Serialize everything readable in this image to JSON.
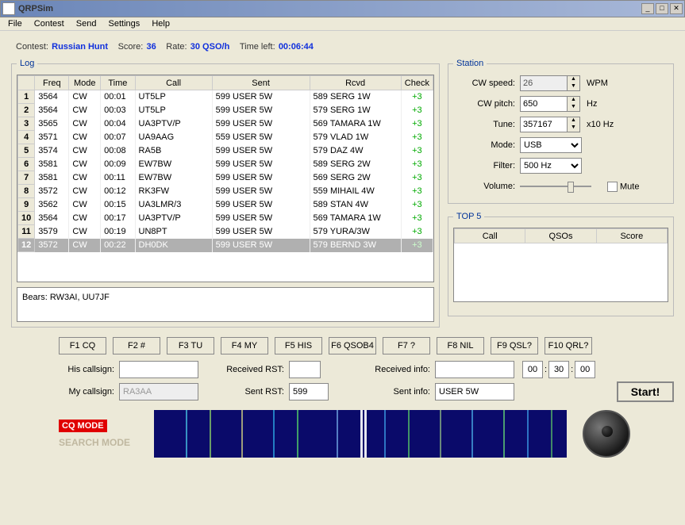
{
  "window": {
    "title": "QRPSim"
  },
  "menu": [
    "File",
    "Contest",
    "Send",
    "Settings",
    "Help"
  ],
  "score": {
    "contest_label": "Contest:",
    "contest": "Russian Hunt",
    "score_label": "Score:",
    "score": "36",
    "rate_label": "Rate:",
    "rate": "30 QSO/h",
    "time_label": "Time left:",
    "time": "00:06:44"
  },
  "log": {
    "legend": "Log",
    "headers": [
      "",
      "Freq",
      "Mode",
      "Time",
      "Call",
      "Sent",
      "Rcvd",
      "Check"
    ],
    "rows": [
      {
        "n": "1",
        "freq": "3564",
        "mode": "CW",
        "time": "00:01",
        "call": "UT5LP",
        "sent": "599 USER 5W",
        "rcvd": "589 SERG 1W",
        "check": "+3"
      },
      {
        "n": "2",
        "freq": "3564",
        "mode": "CW",
        "time": "00:03",
        "call": "UT5LP",
        "sent": "599 USER 5W",
        "rcvd": "579 SERG 1W",
        "check": "+3"
      },
      {
        "n": "3",
        "freq": "3565",
        "mode": "CW",
        "time": "00:04",
        "call": "UA3PTV/P",
        "sent": "599 USER 5W",
        "rcvd": "569 TAMARA 1W",
        "check": "+3"
      },
      {
        "n": "4",
        "freq": "3571",
        "mode": "CW",
        "time": "00:07",
        "call": "UA9AAG",
        "sent": "559 USER 5W",
        "rcvd": "579 VLAD 1W",
        "check": "+3"
      },
      {
        "n": "5",
        "freq": "3574",
        "mode": "CW",
        "time": "00:08",
        "call": "RA5B",
        "sent": "599 USER 5W",
        "rcvd": "579 DAZ 4W",
        "check": "+3"
      },
      {
        "n": "6",
        "freq": "3581",
        "mode": "CW",
        "time": "00:09",
        "call": "EW7BW",
        "sent": "599 USER 5W",
        "rcvd": "589 SERG 2W",
        "check": "+3"
      },
      {
        "n": "7",
        "freq": "3581",
        "mode": "CW",
        "time": "00:11",
        "call": "EW7BW",
        "sent": "599 USER 5W",
        "rcvd": "569 SERG 2W",
        "check": "+3"
      },
      {
        "n": "8",
        "freq": "3572",
        "mode": "CW",
        "time": "00:12",
        "call": "RK3FW",
        "sent": "599 USER 5W",
        "rcvd": "559 MIHAIL 4W",
        "check": "+3"
      },
      {
        "n": "9",
        "freq": "3562",
        "mode": "CW",
        "time": "00:15",
        "call": "UA3LMR/3",
        "sent": "599 USER 5W",
        "rcvd": "589 STAN 4W",
        "check": "+3"
      },
      {
        "n": "10",
        "freq": "3564",
        "mode": "CW",
        "time": "00:17",
        "call": "UA3PTV/P",
        "sent": "599 USER 5W",
        "rcvd": "569 TAMARA 1W",
        "check": "+3"
      },
      {
        "n": "11",
        "freq": "3579",
        "mode": "CW",
        "time": "00:19",
        "call": "UN8PT",
        "sent": "599 USER 5W",
        "rcvd": "579 YURA/3W",
        "check": "+3"
      },
      {
        "n": "12",
        "freq": "3572",
        "mode": "CW",
        "time": "00:22",
        "call": "DH0DK",
        "sent": "599 USER 5W",
        "rcvd": "579 BERND 3W",
        "check": "+3"
      }
    ],
    "bears": "Bears: RW3AI, UU7JF"
  },
  "station": {
    "legend": "Station",
    "cw_speed_label": "CW speed:",
    "cw_speed": "26",
    "wpm": "WPM",
    "cw_pitch_label": "CW pitch:",
    "cw_pitch": "650",
    "hz": "Hz",
    "tune_label": "Tune:",
    "tune": "357167",
    "x10hz": "x10 Hz",
    "mode_label": "Mode:",
    "mode": "USB",
    "filter_label": "Filter:",
    "filter": "500 Hz",
    "volume_label": "Volume:",
    "mute_label": "Mute"
  },
  "top5": {
    "legend": "TOP 5",
    "headers": [
      "Call",
      "QSOs",
      "Score"
    ]
  },
  "fkeys": [
    "F1 CQ",
    "F2 #",
    "F3 TU",
    "F4 MY",
    "F5 HIS",
    "F6 QSOB4",
    "F7 ?",
    "F8 NIL",
    "F9 QSL?",
    "F10 QRL?"
  ],
  "inputs": {
    "his_call_label": "His callsign:",
    "his_call": "",
    "rcvd_rst_label": "Received RST:",
    "rcvd_rst": "",
    "rcvd_info_label": "Received info:",
    "rcvd_info": "",
    "t1": "00",
    "t2": "30",
    "t3": "00",
    "my_call_label": "My callsign:",
    "my_call": "RA3AA",
    "sent_rst_label": "Sent RST:",
    "sent_rst": "599",
    "sent_info_label": "Sent info:",
    "sent_info": "USER 5W",
    "start": "Start!"
  },
  "modes": {
    "cq": "CQ MODE",
    "search": "SEARCH MODE"
  }
}
